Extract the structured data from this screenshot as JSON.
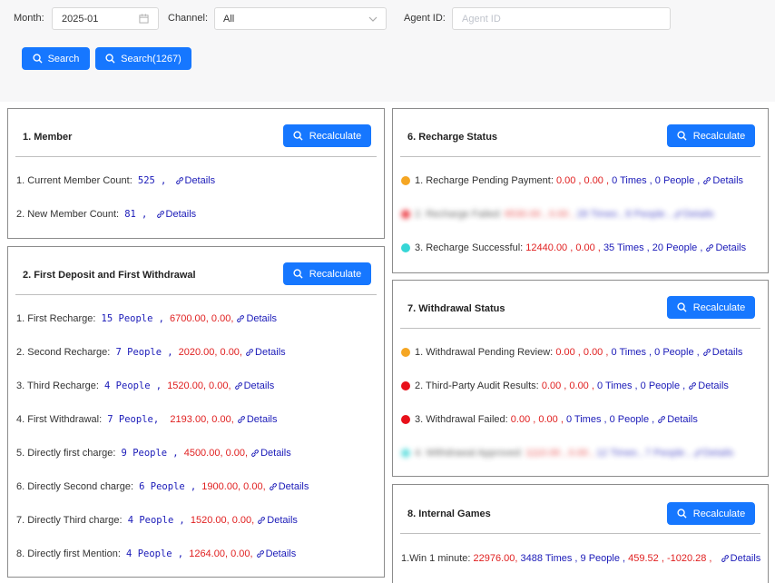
{
  "filters": {
    "month_label": "Month:",
    "month_value": "2025-01",
    "channel_label": "Channel:",
    "channel_value": "All",
    "agent_label": "Agent ID:",
    "agent_placeholder": "Agent ID",
    "search_label": "Search",
    "search_count_label": "Search(1267)"
  },
  "recalc_label": "Recalculate",
  "details_label": "Details",
  "colors": {
    "primary": "#1677ff",
    "orange_dot": "#f5a623",
    "red_dot": "#e8101a",
    "cyan_dot": "#36d6d6",
    "value_blue": "#1a1ab8",
    "value_red": "#e02020"
  },
  "icons": {
    "search": "search-icon",
    "link": "link-icon",
    "calendar": "calendar-icon",
    "chevron": "chevron-down-icon"
  },
  "member": {
    "title": "1. Member",
    "rows": [
      {
        "label": "1. Current Member Count:",
        "count": "525",
        "sep": ",",
        "details": "Details"
      },
      {
        "label": "2. New Member Count:",
        "count": "81",
        "sep": ",",
        "details": "Details"
      }
    ]
  },
  "deposit": {
    "title": "2. First Deposit and First Withdrawal",
    "rows": [
      {
        "label": "1. First Recharge:",
        "count": "15 People",
        "sep": ",",
        "amounts": "6700.00, 0.00,",
        "details": "Details"
      },
      {
        "label": "2. Second Recharge:",
        "count": "7 People",
        "sep": ",",
        "amounts": "2020.00, 0.00,",
        "details": "Details"
      },
      {
        "label": "3. Third Recharge:",
        "count": "4 People",
        "sep": ",",
        "amounts": "1520.00, 0.00,",
        "details": "Details"
      },
      {
        "label": "4. First Withdrawal:",
        "count": "7 People,",
        "sep": "",
        "amounts": "2193.00, 0.00,",
        "details": "Details"
      },
      {
        "label": "5. Directly first charge:",
        "count": "9 People",
        "sep": ",",
        "amounts": "4500.00, 0.00,",
        "details": "Details"
      },
      {
        "label": "6. Directly Second charge:",
        "count": "6 People",
        "sep": ",",
        "amounts": "1900.00, 0.00,",
        "details": "Details"
      },
      {
        "label": "7. Directly Third charge:",
        "count": "4 People",
        "sep": ",",
        "amounts": "1520.00, 0.00,",
        "details": "Details"
      },
      {
        "label": "8. Directly first Mention:",
        "count": "4 People",
        "sep": ",",
        "amounts": "1264.00, 0.00,",
        "details": "Details"
      }
    ]
  },
  "recharge": {
    "title": "6. Recharge Status",
    "rows": [
      {
        "label": "1. Recharge Pending Payment:",
        "amounts": "0.00 , 0.00 ,",
        "times": "0 Times , 0 People ,",
        "details": "Details",
        "blurred": false
      },
      {
        "label": "2. Recharge Failed:",
        "amounts": "6530.00 , 0.00 ,",
        "times": "28 Times , 8 People ,",
        "details": "Details",
        "blurred": true
      },
      {
        "label": "3. Recharge Successful:",
        "amounts": "12440.00 , 0.00 ,",
        "times": "35 Times , 20 People ,",
        "details": "Details",
        "blurred": false
      }
    ]
  },
  "withdrawal": {
    "title": "7. Withdrawal Status",
    "rows": [
      {
        "label": "1. Withdrawal Pending Review:",
        "amounts": "0.00 , 0.00 ,",
        "times": "0 Times , 0 People ,",
        "details": "Details",
        "blurred": false
      },
      {
        "label": "2. Third-Party Audit Results:",
        "amounts": "0.00 , 0.00 ,",
        "times": "0 Times , 0 People ,",
        "details": "Details",
        "blurred": false
      },
      {
        "label": "3. Withdrawal Failed:",
        "amounts": "0.00 , 0.00 ,",
        "times": "0 Times , 0 People ,",
        "details": "Details",
        "blurred": false
      },
      {
        "label": "4. Withdrawal Approved:",
        "amounts": "1110.00 , 0.00 ,",
        "times": "12 Times , 7 People ,",
        "details": "Details",
        "blurred": true
      }
    ]
  },
  "games": {
    "title": "8. Internal Games",
    "rows": [
      {
        "label": "1.Win 1 minute:",
        "amounts": "22976.00,",
        "times": "3488 Times , 9 People ,",
        "tail": "459.52 , -1020.28 ,",
        "details": "Details"
      }
    ]
  }
}
